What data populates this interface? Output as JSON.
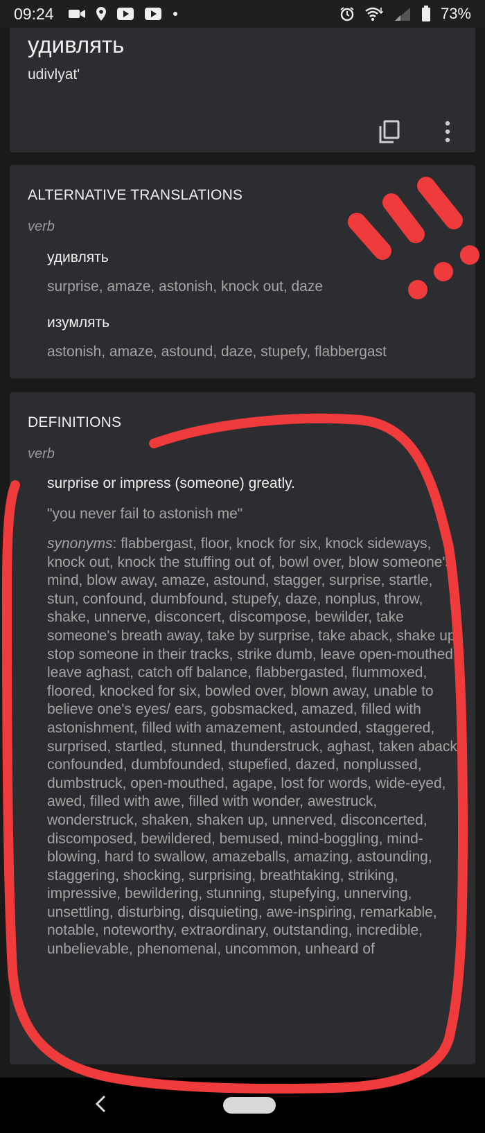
{
  "status_bar": {
    "time": "09:24",
    "battery": "73%",
    "icons_left": [
      "video-call-icon",
      "location-icon",
      "youtube-icon",
      "youtube-icon",
      "dot-icon"
    ],
    "icons_right": [
      "alarm-icon",
      "wifi-icon",
      "signal-icon",
      "battery-icon"
    ]
  },
  "word_card": {
    "word": "удивлять",
    "transliteration": "udivlyat'"
  },
  "alternative_translations": {
    "header": "ALTERNATIVE TRANSLATIONS",
    "part_of_speech": "verb",
    "entries": [
      {
        "term": "удивлять",
        "translations": "surprise, amaze, astonish, knock out, daze"
      },
      {
        "term": "изумлять",
        "translations": "astonish, amaze, astound, daze, stupefy, flabbergast"
      }
    ]
  },
  "definitions": {
    "header": "DEFINITIONS",
    "part_of_speech": "verb",
    "definition": "surprise or impress (someone) greatly.",
    "example": "\"you never fail to astonish me\"",
    "synonyms_label": "synonyms",
    "synonyms": ": flabbergast, floor, knock for six, knock sideways, knock out, knock the stuffing out of, bowl over, blow someone's mind, blow away, amaze, astound, stagger, surprise, startle, stun, confound, dumbfound, stupefy, daze, nonplus, throw, shake, unnerve, disconcert, discompose, bewilder, take someone's breath away, take by surprise, take aback, shake up, stop someone in their tracks, strike dumb, leave open-mouthed, leave aghast, catch off balance, flabbergasted, flummoxed, floored, knocked for six, bowled over, blown away, unable to believe one's eyes/ ears, gobsmacked, amazed, filled with astonishment, filled with amazement, astounded, staggered, surprised, startled, stunned, thunderstruck, aghast, taken aback, confounded, dumbfounded, stupefied, dazed, nonplussed, dumbstruck, open-mouthed, agape, lost for words, wide-eyed, awed, filled with awe, filled with wonder, awestruck, wonderstruck, shaken, shaken up, unnerved, disconcerted, discomposed, bewildered, bemused, mind-boggling, mind-blowing, hard to swallow, amazeballs, amazing, astounding, staggering, shocking, surprising, breathtaking, striking, impressive, bewildering, stunning, stupefying, unnerving, unsettling, disturbing, disquieting, awe-inspiring, remarkable, notable, noteworthy, extraordinary, outstanding, incredible, unbelievable, phenomenal, uncommon, unheard of"
  },
  "colors": {
    "background": "#1a1a1b",
    "card": "#2c2d30",
    "primary_text": "#f0f0f0",
    "secondary_text": "#a4a4a4",
    "annotation_red": "#ef3b3b"
  }
}
